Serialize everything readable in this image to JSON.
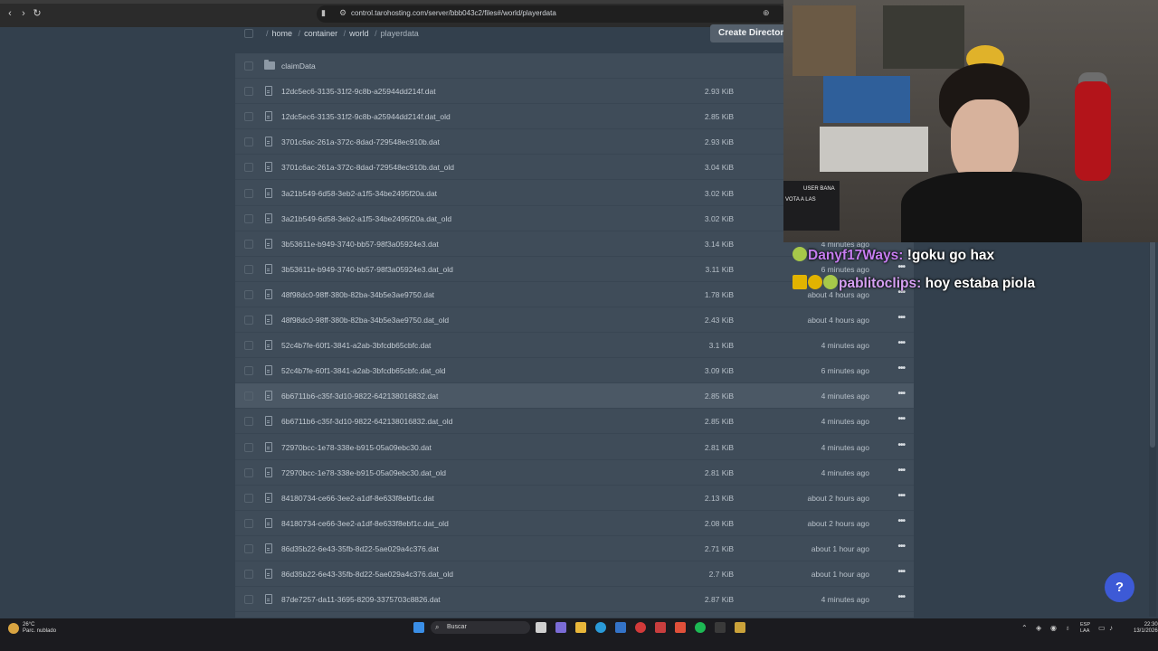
{
  "browser": {
    "url": "control.tarohosting.com/server/bbb043c2/files#/world/playerdata",
    "back_icon": "chevron-left-icon",
    "forward_icon": "chevron-right-icon",
    "reload_icon": "reload-icon"
  },
  "file_manager": {
    "breadcrumb": [
      "home",
      "container",
      "world",
      "playerdata"
    ],
    "create_button": "Create Directory",
    "folder": {
      "name": "claimData"
    },
    "files": [
      {
        "name": "12dc5ec6-3135-31f2-9c8b-a25944dd214f.dat",
        "size": "2.93 KiB",
        "modified": ""
      },
      {
        "name": "12dc5ec6-3135-31f2-9c8b-a25944dd214f.dat_old",
        "size": "2.85 KiB",
        "modified": ""
      },
      {
        "name": "3701c6ac-261a-372c-8dad-729548ec910b.dat",
        "size": "2.93 KiB",
        "modified": ""
      },
      {
        "name": "3701c6ac-261a-372c-8dad-729548ec910b.dat_old",
        "size": "3.04 KiB",
        "modified": ""
      },
      {
        "name": "3a21b549-6d58-3eb2-a1f5-34be2495f20a.dat",
        "size": "3.02 KiB",
        "modified": ""
      },
      {
        "name": "3a21b549-6d58-3eb2-a1f5-34be2495f20a.dat_old",
        "size": "3.02 KiB",
        "modified": ""
      },
      {
        "name": "3b53611e-b949-3740-bb57-98f3a05924e3.dat",
        "size": "3.14 KiB",
        "modified": "4 minutes ago"
      },
      {
        "name": "3b53611e-b949-3740-bb57-98f3a05924e3.dat_old",
        "size": "3.11 KiB",
        "modified": "6 minutes ago"
      },
      {
        "name": "48f98dc0-98ff-380b-82ba-34b5e3ae9750.dat",
        "size": "1.78 KiB",
        "modified": "about 4 hours ago"
      },
      {
        "name": "48f98dc0-98ff-380b-82ba-34b5e3ae9750.dat_old",
        "size": "2.43 KiB",
        "modified": "about 4 hours ago"
      },
      {
        "name": "52c4b7fe-60f1-3841-a2ab-3bfcdb65cbfc.dat",
        "size": "3.1 KiB",
        "modified": "4 minutes ago"
      },
      {
        "name": "52c4b7fe-60f1-3841-a2ab-3bfcdb65cbfc.dat_old",
        "size": "3.09 KiB",
        "modified": "6 minutes ago"
      },
      {
        "name": "6b6711b6-c35f-3d10-9822-642138016832.dat",
        "size": "2.85 KiB",
        "modified": "4 minutes ago"
      },
      {
        "name": "6b6711b6-c35f-3d10-9822-642138016832.dat_old",
        "size": "2.85 KiB",
        "modified": "4 minutes ago"
      },
      {
        "name": "72970bcc-1e78-338e-b915-05a09ebc30.dat",
        "size": "2.81 KiB",
        "modified": "4 minutes ago"
      },
      {
        "name": "72970bcc-1e78-338e-b915-05a09ebc30.dat_old",
        "size": "2.81 KiB",
        "modified": "4 minutes ago"
      },
      {
        "name": "84180734-ce66-3ee2-a1df-8e633f8ebf1c.dat",
        "size": "2.13 KiB",
        "modified": "about 2 hours ago"
      },
      {
        "name": "84180734-ce66-3ee2-a1df-8e633f8ebf1c.dat_old",
        "size": "2.08 KiB",
        "modified": "about 2 hours ago"
      },
      {
        "name": "86d35b22-6e43-35fb-8d22-5ae029a4c376.dat",
        "size": "2.71 KiB",
        "modified": "about 1 hour ago"
      },
      {
        "name": "86d35b22-6e43-35fb-8d22-5ae029a4c376.dat_old",
        "size": "2.7 KiB",
        "modified": "about 1 hour ago"
      },
      {
        "name": "87de7257-da11-3695-8209-3375703c8826.dat",
        "size": "2.87 KiB",
        "modified": "4 minutes ago"
      }
    ],
    "more_icon": "more-dots-icon",
    "hover_row_index": 12
  },
  "stream_overlay": {
    "cam_chat_lines": [
      "USER BANA",
      "VOTA A LAS"
    ],
    "chat": [
      {
        "user": "Danyf17Ways:",
        "message": "!goku go hax",
        "badge_color": "#a7c84a"
      },
      {
        "user": "pablitoclips:",
        "message": "hoy estaba piola",
        "badge_color": "#e2b300"
      }
    ],
    "partial_lines": [
      "4 minutes ago",
      "6 minutes ago"
    ]
  },
  "help_button": "?",
  "taskbar": {
    "weather_temp": "26°C",
    "weather_desc": "Parc. nublado",
    "search_placeholder": "Buscar",
    "lang_top": "ESP",
    "lang_bottom": "LAA",
    "time": "22:30",
    "date": "13/1/2026"
  }
}
